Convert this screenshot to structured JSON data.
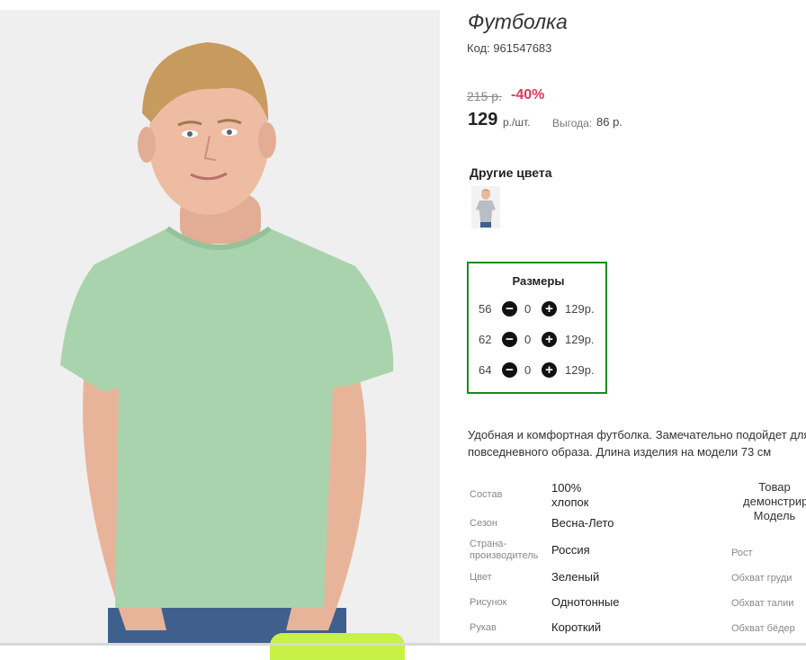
{
  "product": {
    "title": "Футболка",
    "code": "Код: 961547683",
    "old_price": "215 р.",
    "discount": "-40%",
    "price": "129",
    "unit": "р./шт.",
    "benefit_label": "Выгода:",
    "benefit_value": "86 р."
  },
  "colors": {
    "title": "Другие цвета"
  },
  "sizes": {
    "title": "Размеры",
    "rows": [
      {
        "size": "56",
        "qty": "0",
        "price": "129р."
      },
      {
        "size": "62",
        "qty": "0",
        "price": "129р."
      },
      {
        "size": "64",
        "qty": "0",
        "price": "129р."
      }
    ]
  },
  "description": {
    "line1": "Удобная и комфортная футболка. Замечательно подойдет для",
    "line2": "повседневного образа. Длина изделия на модели 73 см"
  },
  "properties": [
    {
      "label": "Состав",
      "value": "100% хлопок"
    },
    {
      "label": "Сезон",
      "value": "Весна-Лето"
    },
    {
      "label": "Страна-производитель",
      "value": "Россия"
    },
    {
      "label": "Цвет",
      "value": "Зеленый"
    },
    {
      "label": "Рисунок",
      "value": "Однотонные"
    },
    {
      "label": "Рукав",
      "value": "Короткий"
    }
  ],
  "model": {
    "note": [
      "Товар",
      "демонстрирует",
      "Модель"
    ],
    "params": [
      "Рост",
      "Обхват груди",
      "Обхват талии",
      "Обхват бёдер"
    ]
  },
  "colors_palette": {
    "accent_green": "#1c8a1c",
    "discount_red": "#e0365a",
    "button_lime": "#c6f146",
    "shirt_green": "#a9d3ad"
  }
}
